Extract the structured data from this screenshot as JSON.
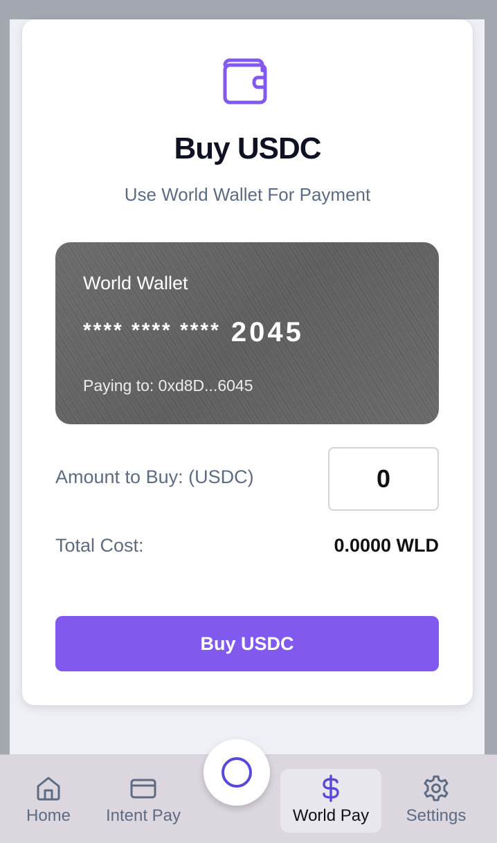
{
  "header": {
    "icon": "wallet-icon",
    "title": "Buy USDC",
    "subtitle": "Use World Wallet For Payment"
  },
  "wallet_card": {
    "name": "World Wallet",
    "number_mask": "**** **** ****",
    "number_last4": "2045",
    "paying_to": "Paying to: 0xd8D...6045"
  },
  "form": {
    "amount_label": "Amount to Buy: (USDC)",
    "amount_value": "0",
    "total_label": "Total Cost:",
    "total_value": "0.0000 WLD",
    "buy_button": "Buy USDC"
  },
  "nav": {
    "items": [
      {
        "label": "Home",
        "icon": "home-icon"
      },
      {
        "label": "Intent Pay",
        "icon": "credit-card-icon"
      },
      {
        "label": "World Pay",
        "icon": "dollar-icon",
        "active": true
      },
      {
        "label": "Settings",
        "icon": "gear-icon"
      }
    ],
    "center_icon": "circle-icon"
  },
  "colors": {
    "accent": "#8159ee",
    "active_icon": "#5848d8",
    "text_muted": "#5d6b82"
  }
}
